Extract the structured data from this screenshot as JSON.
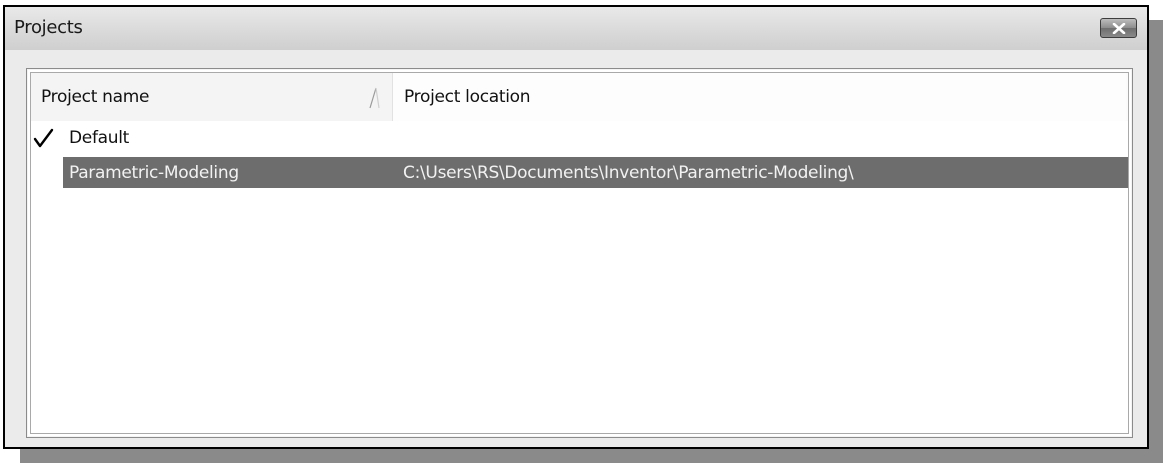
{
  "window": {
    "title": "Projects",
    "close_icon": "close-icon"
  },
  "table": {
    "columns": [
      {
        "label": "Project name",
        "sort_icon": "sort-ascending-icon"
      },
      {
        "label": "Project location"
      }
    ],
    "rows": [
      {
        "active_icon": "checkmark-icon",
        "name": "Default",
        "location": ""
      },
      {
        "active_icon": "",
        "name": "Parametric-Modeling",
        "location": "C:\\Users\\RS\\Documents\\Inventor\\Parametric-Modeling\\",
        "selected": true
      }
    ]
  },
  "colors": {
    "selection": "#6d6d6d",
    "titlebar": "#dadada",
    "close_button": "#8c8c8c"
  }
}
